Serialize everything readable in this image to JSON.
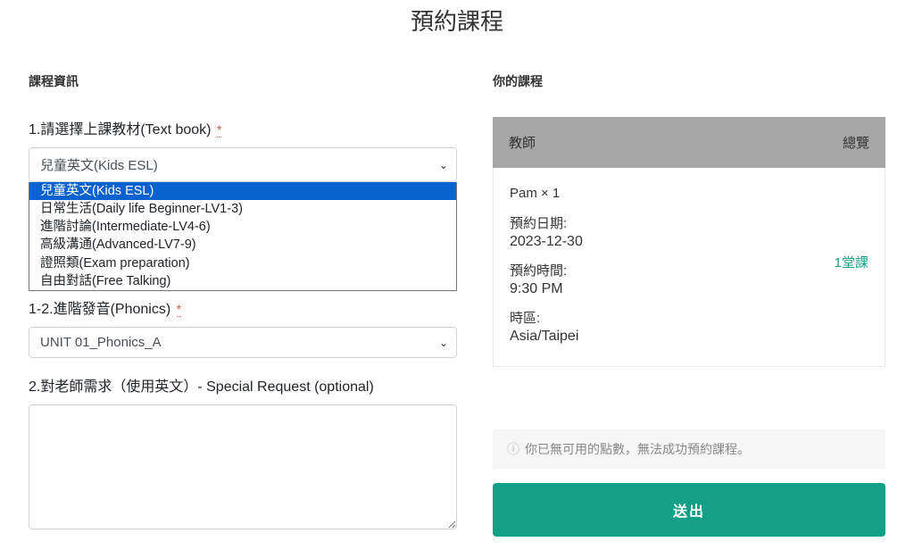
{
  "page_title": "預約課程",
  "left_section_label": "課程資訊",
  "right_section_label": "你的課程",
  "q1": {
    "label": "1.請選擇上課教材(Text book)",
    "required": "*",
    "selected": "兒童英文(Kids ESL)",
    "options": [
      "兒童英文(Kids ESL)",
      "日常生活(Daily life Beginner-LV1-3)",
      "進階討論(Intermediate-LV4-6)",
      "高級溝通(Advanced-LV7-9)",
      "證照類(Exam preparation)",
      "自由對話(Free Talking)"
    ]
  },
  "q1_2": {
    "label": "1-2.進階發音(Phonics)",
    "required": "*",
    "selected": "UNIT 01_Phonics_A"
  },
  "q2": {
    "label": "2.對老師需求（使用英文）- Special Request (optional)"
  },
  "summary": {
    "header_left": "教師",
    "header_right": "總覽",
    "teacher": "Pam  × 1",
    "date_label": "預約日期:",
    "date_value": "2023-12-30",
    "time_label": "預約時間:",
    "time_value": "9:30 PM",
    "tz_label": "時區:",
    "tz_value": "Asia/Taipei",
    "credit": "1堂課"
  },
  "notice": "你已無可用的點數，無法成功預約課程。",
  "submit": "送出"
}
